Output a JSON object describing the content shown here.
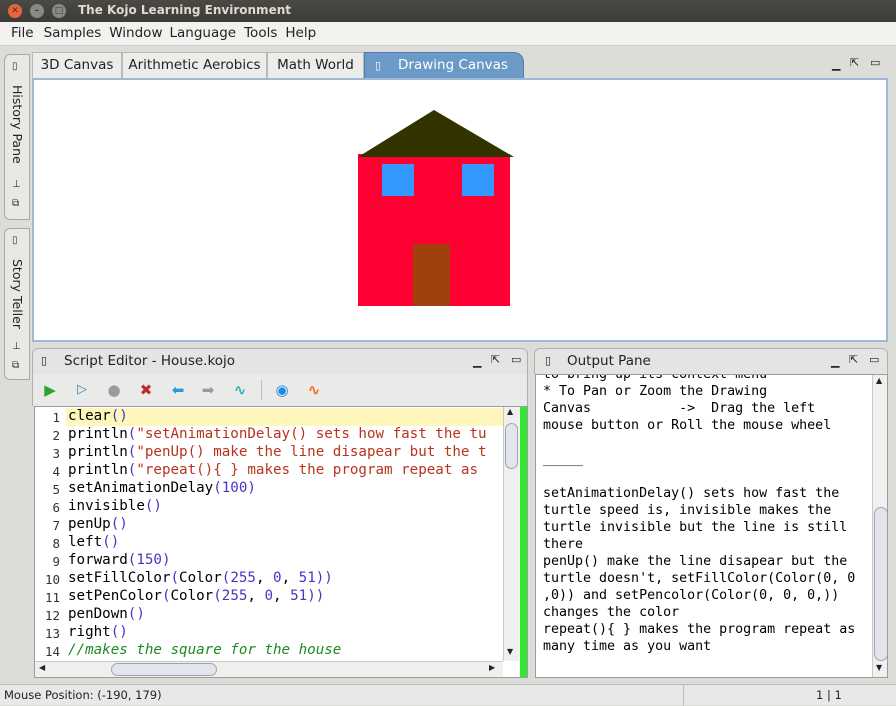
{
  "window": {
    "title": "The Kojo Learning Environment",
    "controls": [
      "close-icon",
      "minimize-icon",
      "maximize-icon"
    ]
  },
  "menu": {
    "items": [
      "File",
      "Samples",
      "Window",
      "Language",
      "Tools",
      "Help"
    ]
  },
  "side_tabs": [
    {
      "label": "History Pane"
    },
    {
      "label": "Story Teller"
    }
  ],
  "canvas_tabs": [
    {
      "label": "3D Canvas"
    },
    {
      "label": "Arithmetic Aerobics"
    },
    {
      "label": "Math World"
    },
    {
      "label": "Drawing Canvas",
      "active": true
    }
  ],
  "drawing": {
    "roof_color": "#333300",
    "wall_color": "#ff0033",
    "window_color": "#3399ff",
    "door_color": "#a0410d"
  },
  "editor": {
    "title": "Script Editor - House.kojo",
    "toolbar_icons": [
      "run-icon",
      "run-worksheet-icon",
      "stop-icon",
      "clear-icon",
      "undo-icon",
      "redo-icon",
      "format-icon",
      "stepper-icon",
      "staging-icon"
    ],
    "line_numbers": [
      "1",
      "2",
      "3",
      "4",
      "5",
      "6",
      "7",
      "8",
      "9",
      "10",
      "11",
      "12",
      "13",
      "14"
    ],
    "lines": [
      [
        [
          "kw",
          "clear"
        ],
        [
          "paren",
          "()"
        ]
      ],
      [
        [
          "kw",
          "println"
        ],
        [
          "paren",
          "("
        ],
        [
          "str",
          "\"setAnimationDelay() sets how fast the tu"
        ]
      ],
      [
        [
          "kw",
          "println"
        ],
        [
          "paren",
          "("
        ],
        [
          "str",
          "\"penUp() make the line disapear but the t"
        ]
      ],
      [
        [
          "kw",
          "println"
        ],
        [
          "paren",
          "("
        ],
        [
          "str",
          "\"repeat(){ } makes the program repeat as"
        ]
      ],
      [
        [
          "kw",
          "setAnimationDelay"
        ],
        [
          "paren",
          "("
        ],
        [
          "num",
          "100"
        ],
        [
          "paren",
          ")"
        ]
      ],
      [
        [
          "kw",
          "invisible"
        ],
        [
          "paren",
          "()"
        ]
      ],
      [
        [
          "kw",
          "penUp"
        ],
        [
          "paren",
          "()"
        ]
      ],
      [
        [
          "kw",
          "left"
        ],
        [
          "paren",
          "()"
        ]
      ],
      [
        [
          "kw",
          "forward"
        ],
        [
          "paren",
          "("
        ],
        [
          "num",
          "150"
        ],
        [
          "paren",
          ")"
        ]
      ],
      [
        [
          "kw",
          "setFillColor"
        ],
        [
          "paren",
          "("
        ],
        [
          "kw",
          "Color"
        ],
        [
          "paren",
          "("
        ],
        [
          "num",
          "255"
        ],
        [
          "kw",
          ", "
        ],
        [
          "num",
          "0"
        ],
        [
          "kw",
          ", "
        ],
        [
          "num",
          "51"
        ],
        [
          "paren",
          "))"
        ]
      ],
      [
        [
          "kw",
          "setPenColor"
        ],
        [
          "paren",
          "("
        ],
        [
          "kw",
          "Color"
        ],
        [
          "paren",
          "("
        ],
        [
          "num",
          "255"
        ],
        [
          "kw",
          ", "
        ],
        [
          "num",
          "0"
        ],
        [
          "kw",
          ", "
        ],
        [
          "num",
          "51"
        ],
        [
          "paren",
          "))"
        ]
      ],
      [
        [
          "kw",
          "penDown"
        ],
        [
          "paren",
          "()"
        ]
      ],
      [
        [
          "kw",
          "right"
        ],
        [
          "paren",
          "()"
        ]
      ],
      [
        [
          "cmt",
          "//makes the square for the house"
        ]
      ]
    ]
  },
  "output": {
    "title": "Output Pane",
    "lines": [
      "to bring up its context menu",
      "* To Pan or Zoom the Drawing",
      "Canvas           ->  Drag the left",
      "mouse button or Roll the mouse wheel",
      "",
      "_____",
      "",
      "setAnimationDelay() sets how fast the",
      "turtle speed is, invisible makes the",
      "turtle invisible but the line is still",
      "there",
      "penUp() make the line disapear but the",
      "turtle doesn't, setFillColor(Color(0, 0",
      ",0)) and setPencolor(Color(0, 0, 0,))",
      "changes the color",
      "repeat(){ } makes the program repeat as",
      "many time as you want"
    ]
  },
  "status": {
    "mouse_position": "Mouse Position: (-190, 179)",
    "caret_position": "1 | 1"
  }
}
